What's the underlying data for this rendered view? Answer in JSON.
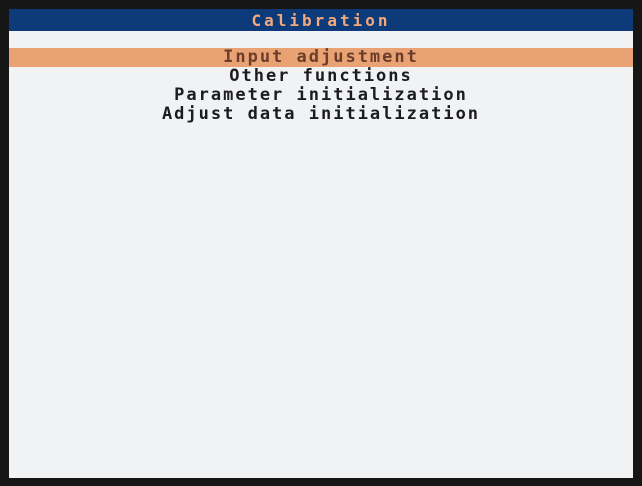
{
  "header": {
    "title": "Calibration"
  },
  "menu": {
    "selected_index": 0,
    "items": [
      {
        "label": "Input adjustment"
      },
      {
        "label": "Other functions"
      },
      {
        "label": "Parameter initialization"
      },
      {
        "label": "Adjust data initialization"
      }
    ]
  },
  "colors": {
    "title_bar": "#0d3a78",
    "title_text": "#f4a97c",
    "highlight": "#e9a273",
    "screen_bg": "#f1f2f3"
  }
}
